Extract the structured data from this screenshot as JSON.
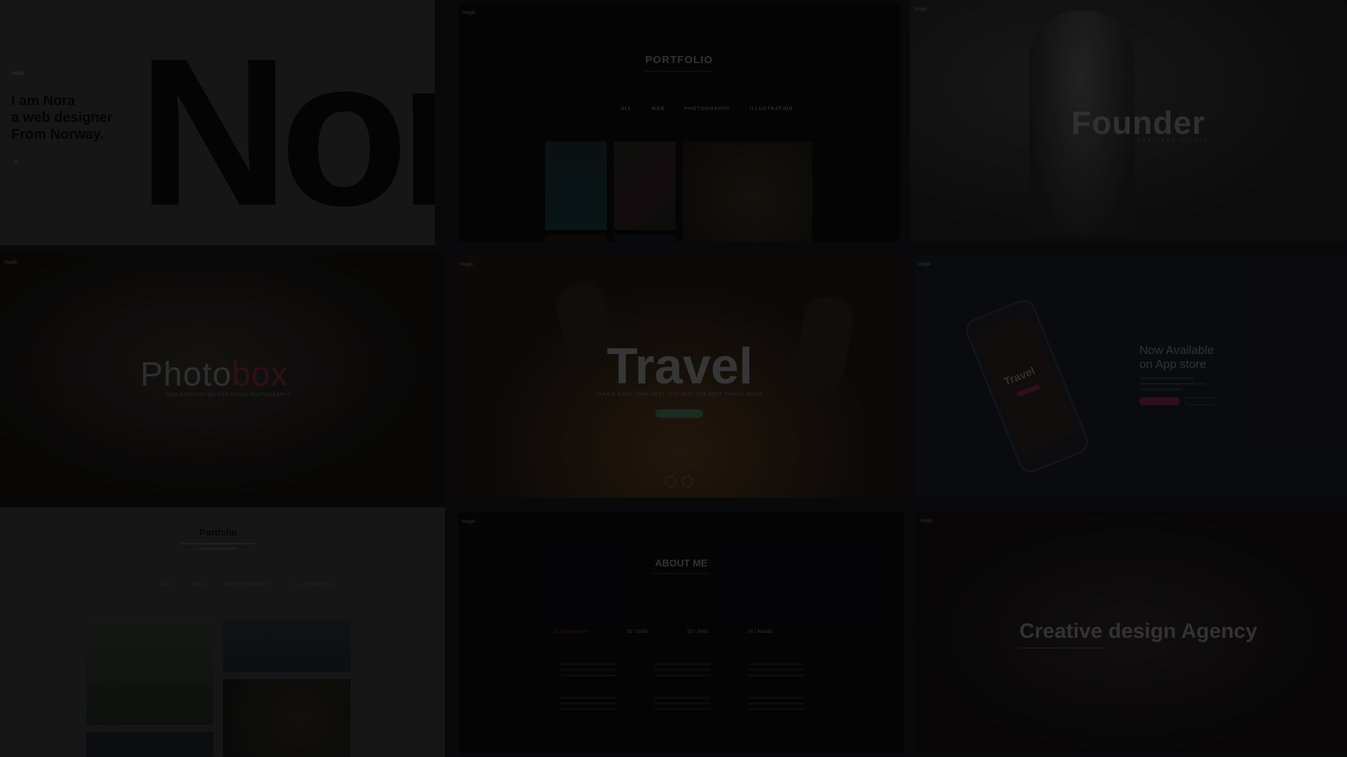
{
  "tiles": {
    "nora": {
      "intro": "I am Nora\na web designer\nFrom Norway.",
      "hero": "Nor",
      "tag": "Hello"
    },
    "portfolio_dark": {
      "brand": "Magik",
      "title": "PORTFOLIO",
      "nav": [
        "ALL",
        "WEB",
        "PHOTOGRAPHY",
        "ILLUSTRATION"
      ]
    },
    "founder": {
      "brand": "Magik",
      "title": "Founder",
      "subtitle": "DESIGNER STUDIO"
    },
    "photobox": {
      "brand": "Magik",
      "title_a": "Photo",
      "title_b": "box",
      "tagline": "NEW DESTINATION FOR STOCK PHOTOGRAPHY"
    },
    "travel": {
      "brand": "Magik",
      "title": "Travel",
      "tagline": "PLAN & BOOK YOUR NEXT TRIP WITH THE BEST TRAVEL GUIDE"
    },
    "app": {
      "brand": "Magik",
      "heading": "Now Available\non App store",
      "phone_title": "Travel"
    },
    "portfolio_light": {
      "title": "Portfolio",
      "nav": [
        "ALL",
        "WEB",
        "PHOTOGRAPHY",
        "ILLUSTRATION"
      ]
    },
    "about": {
      "brand": "Magik",
      "title": "ABOUT ME",
      "tabs": [
        "01 / Experience",
        "02 / Skills",
        "03 / Skills",
        "04 / Awards"
      ]
    },
    "agency": {
      "brand": "Magik",
      "title": "Creative design Agency"
    }
  },
  "colors": {
    "accent_pink": "#7a1f3a",
    "accent_teal": "#1f5a4a"
  }
}
